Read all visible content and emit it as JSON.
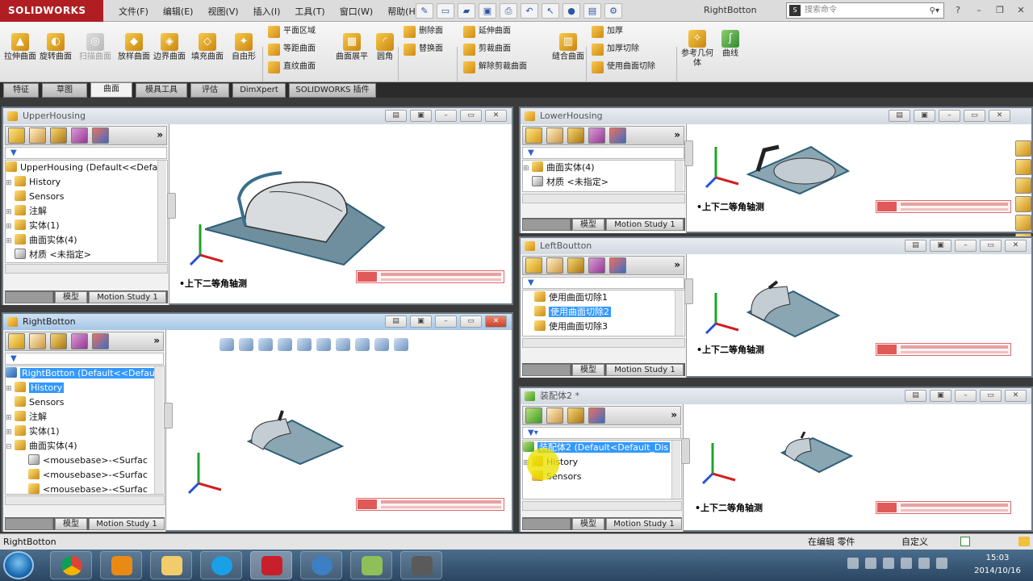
{
  "app": {
    "logo": "SOLIDWORKS",
    "doc_title": "RightBotton"
  },
  "menu": [
    "文件(F)",
    "编辑(E)",
    "视图(V)",
    "插入(I)",
    "工具(T)",
    "窗口(W)",
    "帮助(H)"
  ],
  "search": {
    "placeholder": "搜索命令",
    "icon": "solidworks-search-icon"
  },
  "ribbon": {
    "big_buttons": [
      "拉伸曲面",
      "旋转曲面",
      "扫描曲面",
      "放样曲面",
      "边界曲面",
      "填充曲面",
      "自由形"
    ],
    "col1": [
      "平面区域",
      "等距曲面",
      "直纹曲面"
    ],
    "col1b": "曲面展平",
    "col1c": "圆角",
    "col2": [
      "删除面",
      "替换面"
    ],
    "col3": [
      "延伸曲面",
      "剪裁曲面",
      "解除剪裁曲面"
    ],
    "col3b": "缝合曲面",
    "col4": [
      "加厚",
      "加厚切除",
      "使用曲面切除"
    ],
    "col5": [
      "参考几何体",
      "曲线"
    ]
  },
  "command_tabs": [
    {
      "label": "特征",
      "active": false
    },
    {
      "label": "草图",
      "active": false
    },
    {
      "label": "曲面",
      "active": true
    },
    {
      "label": "模具工具",
      "active": false
    },
    {
      "label": "评估",
      "active": false
    },
    {
      "label": "DimXpert",
      "active": false
    },
    {
      "label": "SOLIDWORKS 插件",
      "active": false
    }
  ],
  "docs": {
    "upper": {
      "title": "UpperHousing",
      "tree": [
        "UpperHousing  (Default<<Defa",
        "History",
        "Sensors",
        "注解",
        "实体(1)",
        "曲面实体(4)",
        "材质 <未指定>"
      ],
      "view": "上下二等角轴测",
      "tabs": [
        "模型",
        "Motion Study 1"
      ]
    },
    "lower": {
      "title": "LowerHousing",
      "tree": [
        "曲面实体(4)",
        "材质 <未指定>"
      ],
      "view": "上下二等角轴测",
      "tabs": [
        "模型",
        "Motion Study 1"
      ]
    },
    "right": {
      "title": "RightBotton",
      "tree": [
        "RightBotton  (Default<<Defau",
        "History",
        "Sensors",
        "注解",
        "实体(1)",
        "曲面实体(4)",
        "<mousebase>-<Surfac",
        "<mousebase>-<Surfac",
        "<mousebase>-<Surfac"
      ],
      "tabs": [
        "模型",
        "Motion Study 1"
      ]
    },
    "left": {
      "title": "LeftBoutton",
      "tree": [
        "使用曲面切除1",
        "使用曲面切除2",
        "使用曲面切除3"
      ],
      "view": "上下二等角轴测",
      "tabs": [
        "模型",
        "Motion Study 1"
      ]
    },
    "part": {
      "title": "装配体2 *",
      "tree": [
        "装配体2  (Default<Default_Dis",
        "History",
        "Sensors"
      ],
      "view": "上下二等角轴测",
      "tabs": [
        "模型",
        "Motion Study 1"
      ]
    }
  },
  "status": {
    "left": "RightBotton",
    "mode": "在编辑 零件",
    "custom": "自定义"
  },
  "clock": {
    "time": "15:03",
    "date": "2014/10/16"
  },
  "colors": {
    "brand": "#b01e23",
    "selection": "#3399ff",
    "model": "#3a6f8a"
  }
}
